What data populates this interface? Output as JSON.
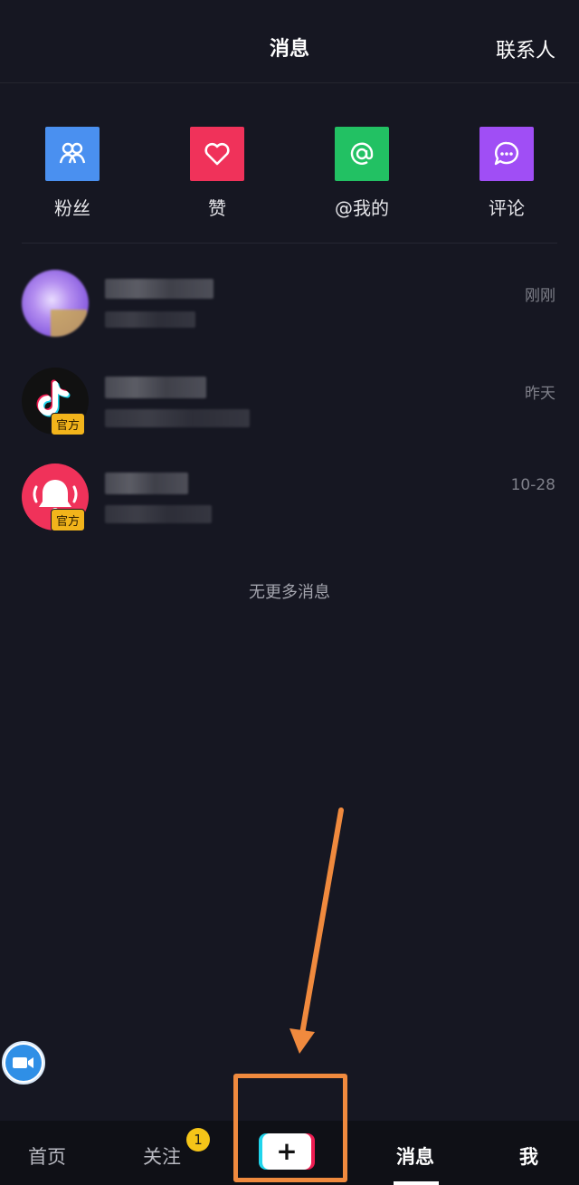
{
  "header": {
    "title": "消息",
    "contacts": "联系人"
  },
  "categories": [
    {
      "label": "粉丝",
      "icon": "fans-icon",
      "color": "#4a90f0"
    },
    {
      "label": "赞",
      "icon": "heart-icon",
      "color": "#f0325a"
    },
    {
      "label": "@我的",
      "icon": "at-icon",
      "color": "#22c163"
    },
    {
      "label": "评论",
      "icon": "comment-icon",
      "color": "#a04ef5"
    }
  ],
  "messages": [
    {
      "time": "刚刚",
      "badge": ""
    },
    {
      "time": "昨天",
      "badge": "官方"
    },
    {
      "time": "10-28",
      "badge": "官方"
    }
  ],
  "end_text": "无更多消息",
  "nav": {
    "home": "首页",
    "follow": "关注",
    "follow_badge": "1",
    "create": "+",
    "messages": "消息",
    "me": "我"
  },
  "colors": {
    "background": "#161722",
    "annotation": "#f08a3e"
  }
}
